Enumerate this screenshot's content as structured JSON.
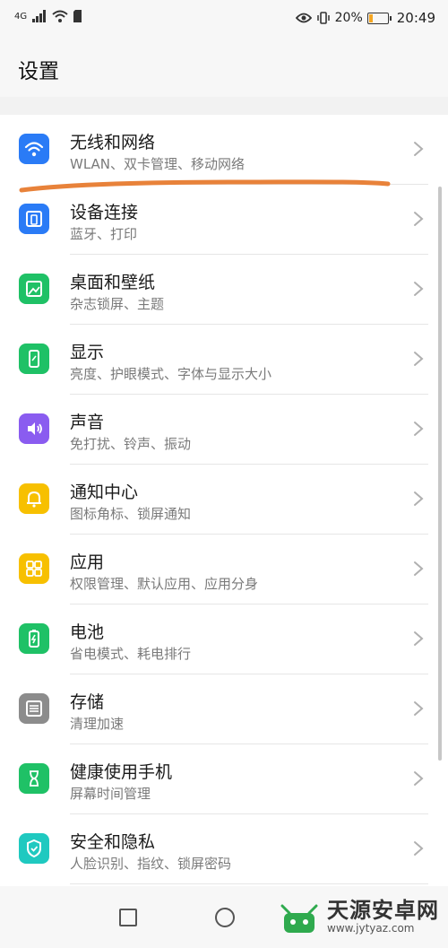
{
  "status_bar": {
    "network": "4G",
    "battery_percent": "20%",
    "battery_level": 0.2,
    "time": "20:49"
  },
  "header": {
    "title": "设置"
  },
  "settings": [
    {
      "label": "无线和网络",
      "sub": "WLAN、双卡管理、移动网络",
      "icon": "wifi-icon",
      "color": "#2a7bf6"
    },
    {
      "label": "设备连接",
      "sub": "蓝牙、打印",
      "icon": "device-connection-icon",
      "color": "#2a7bf6"
    },
    {
      "label": "桌面和壁纸",
      "sub": "杂志锁屏、主题",
      "icon": "wallpaper-icon",
      "color": "#1fc166"
    },
    {
      "label": "显示",
      "sub": "亮度、护眼模式、字体与显示大小",
      "icon": "display-icon",
      "color": "#1fc166"
    },
    {
      "label": "声音",
      "sub": "免打扰、铃声、振动",
      "icon": "sound-icon",
      "color": "#8a5cf0"
    },
    {
      "label": "通知中心",
      "sub": "图标角标、锁屏通知",
      "icon": "notification-bell-icon",
      "color": "#f7c000"
    },
    {
      "label": "应用",
      "sub": "权限管理、默认应用、应用分身",
      "icon": "apps-grid-icon",
      "color": "#f7c000"
    },
    {
      "label": "电池",
      "sub": "省电模式、耗电排行",
      "icon": "battery-icon",
      "color": "#1fc166"
    },
    {
      "label": "存储",
      "sub": "清理加速",
      "icon": "storage-icon",
      "color": "#8c8c8c"
    },
    {
      "label": "健康使用手机",
      "sub": "屏幕时间管理",
      "icon": "hourglass-icon",
      "color": "#1fc166"
    },
    {
      "label": "安全和隐私",
      "sub": "人脸识别、指纹、锁屏密码",
      "icon": "shield-icon",
      "color": "#1fc9c0"
    }
  ],
  "watermark": {
    "title": "天源安卓网",
    "url": "www.jytyaz.com"
  }
}
